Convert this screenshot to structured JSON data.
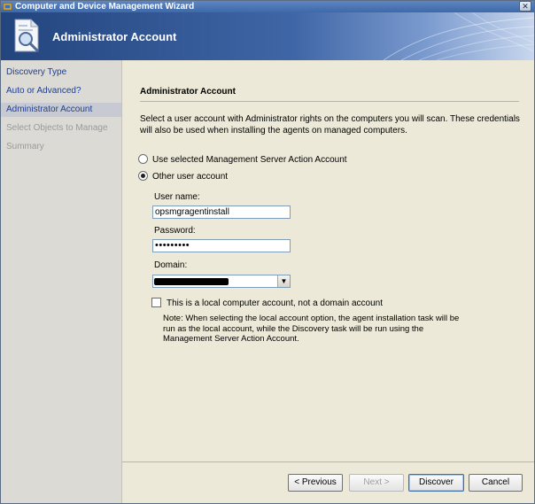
{
  "window": {
    "title": "Computer and Device Management Wizard",
    "close_glyph": "✕"
  },
  "banner": {
    "title": "Administrator Account",
    "icon": "magnifier-document-icon"
  },
  "nav": {
    "items": [
      {
        "label": "Discovery Type",
        "state": "link"
      },
      {
        "label": "Auto or Advanced?",
        "state": "link"
      },
      {
        "label": "Administrator Account",
        "state": "active"
      },
      {
        "label": "Select Objects to Manage",
        "state": "disabled"
      },
      {
        "label": "Summary",
        "state": "disabled"
      }
    ]
  },
  "content": {
    "section_title": "Administrator Account",
    "description": "Select a user account with Administrator rights on the computers you will scan. These credentials will also be used when installing the agents on managed computers.",
    "radio_action_account": "Use selected Management Server Action Account",
    "radio_other_user": "Other user account",
    "selected_radio": "other_user",
    "username_label": "User name:",
    "username_value": "opsmgragentinstall",
    "password_label": "Password:",
    "password_value": "•••••••••",
    "domain_label": "Domain:",
    "domain_dropdown_glyph": "▼",
    "local_account_checkbox": "This is a local computer account, not a domain account",
    "local_account_checked": false,
    "note": "Note:  When selecting the local account option, the agent installation task will be run as the local account, while the Discovery task will be run using the Management Server Action Account."
  },
  "buttons": {
    "previous": "< Previous",
    "next": "Next >",
    "discover": "Discover",
    "cancel": "Cancel"
  },
  "colors": {
    "nav_link": "#1f3e8e",
    "banner_dark": "#23457e",
    "active_nav": "#c7cad3"
  }
}
